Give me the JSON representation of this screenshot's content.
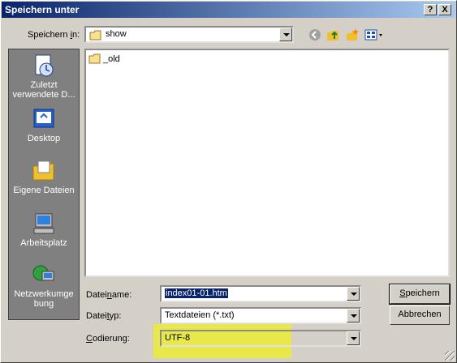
{
  "window": {
    "title": "Speichern unter"
  },
  "titlebar": {
    "help": "?",
    "close": "X"
  },
  "save_in": {
    "label_pre": "Speichern ",
    "label_ul": "i",
    "label_post": "n:",
    "value": "show"
  },
  "places": [
    {
      "label1": "Zuletzt",
      "label2": "verwendete D...",
      "icon": "recent-icon"
    },
    {
      "label1": "Desktop",
      "label2": "",
      "icon": "desktop-icon"
    },
    {
      "label1": "Eigene Dateien",
      "label2": "",
      "icon": "my-documents-icon"
    },
    {
      "label1": "Arbeitsplatz",
      "label2": "",
      "icon": "my-computer-icon"
    },
    {
      "label1": "Netzwerkumge",
      "label2": "bung",
      "icon": "network-icon"
    }
  ],
  "files": [
    {
      "name": "_old",
      "icon": "folder-icon"
    }
  ],
  "filename": {
    "label_pre": "Datei",
    "label_ul": "n",
    "label_post": "ame:",
    "value": "index01-01.htm"
  },
  "filetype": {
    "label_pre": "Datei",
    "label_ul": "t",
    "label_post": "yp:",
    "value": "Textdateien (*.txt)"
  },
  "encoding": {
    "label_ul": "C",
    "label_post": "odierung:",
    "value": "UTF-8"
  },
  "buttons": {
    "save_ul": "S",
    "save_post": "peichern",
    "cancel": "Abbrechen"
  },
  "colors": {
    "titlebar": "#0a246a",
    "highlight": "#f0f020",
    "places_bg": "#808080"
  }
}
